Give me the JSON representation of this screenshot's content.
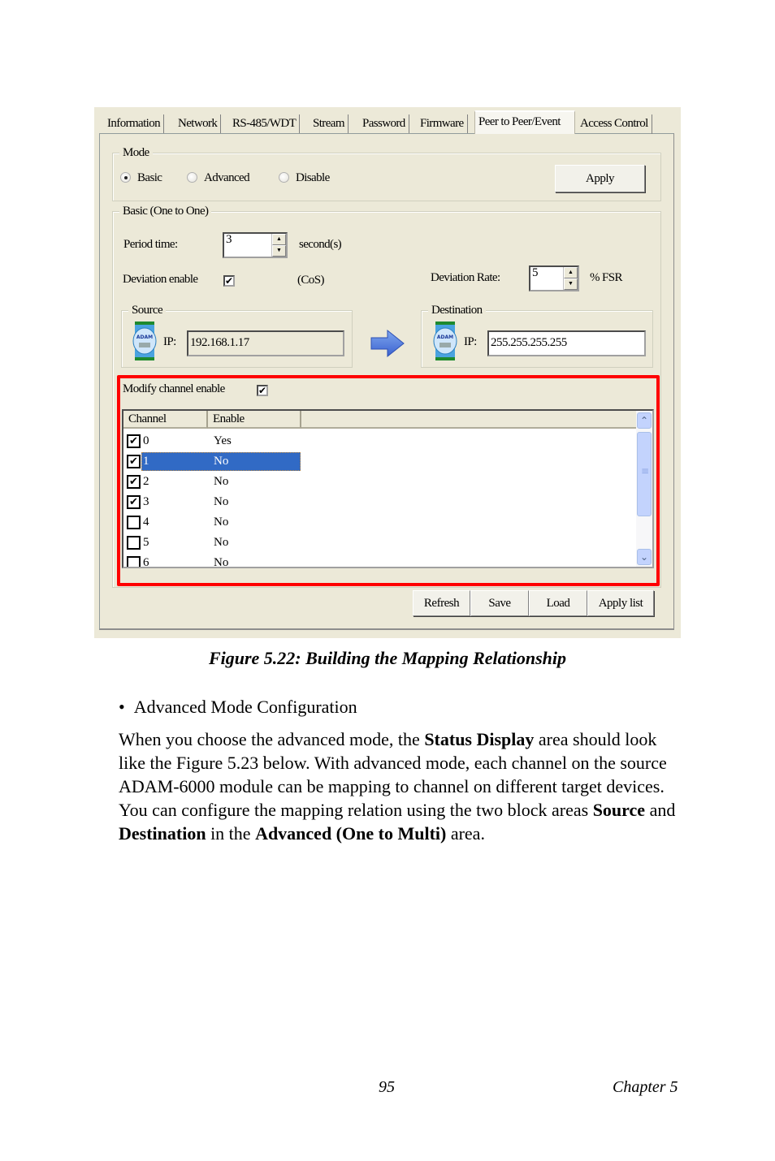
{
  "tabs": [
    {
      "label": "Information"
    },
    {
      "label": "Network"
    },
    {
      "label": "RS-485/WDT"
    },
    {
      "label": "Stream"
    },
    {
      "label": "Password"
    },
    {
      "label": "Firmware"
    },
    {
      "label": "Peer to Peer/Event",
      "active": true
    },
    {
      "label": "Access Control"
    }
  ],
  "mode": {
    "legend": "Mode",
    "options": [
      {
        "label": "Basic",
        "selected": true
      },
      {
        "label": "Advanced",
        "selected": false
      },
      {
        "label": "Disable",
        "selected": false
      }
    ],
    "apply_label": "Apply"
  },
  "basic": {
    "legend": "Basic (One to One)",
    "period_label": "Period time:",
    "period_value": "3",
    "period_unit": "second(s)",
    "deviation_label": "Deviation enable",
    "deviation_checked": "✔",
    "cos_label": "(CoS)",
    "rate_label": "Deviation Rate:",
    "rate_value": "5",
    "rate_unit": "% FSR"
  },
  "source": {
    "legend": "Source",
    "ip_label": "IP:",
    "ip": "192.168.1.17"
  },
  "destination": {
    "legend": "Destination",
    "ip_label": "IP:",
    "ip": "255.255.255.255"
  },
  "channels": {
    "modify_label": "Modify channel enable",
    "modify_checked": "✔",
    "headers": {
      "channel": "Channel",
      "enable": "Enable"
    },
    "rows": [
      {
        "checked": "✔",
        "channel": "0",
        "enable": "Yes"
      },
      {
        "checked": "✔",
        "channel": "1",
        "enable": "No",
        "selected": true
      },
      {
        "checked": "✔",
        "channel": "2",
        "enable": "No"
      },
      {
        "checked": "✔",
        "channel": "3",
        "enable": "No"
      },
      {
        "checked": "",
        "channel": "4",
        "enable": "No"
      },
      {
        "checked": "",
        "channel": "5",
        "enable": "No"
      },
      {
        "checked": "",
        "channel": "6",
        "enable": "No"
      }
    ]
  },
  "buttons": {
    "refresh": "Refresh",
    "save": "Save",
    "load": "Load",
    "apply_list": "Apply list"
  },
  "highlight_color": "#ff0000",
  "selection_color": "#316ac5",
  "document": {
    "caption": "Figure 5.22: Building the Mapping Relationship",
    "bullet": "Advanced Mode Configuration",
    "para": [
      {
        "t": "When you choose the advanced mode, the "
      },
      {
        "t": "Status Display",
        "b": true
      },
      {
        "t": " area should look like the Figure 5.23 below. With advanced mode, each channel on the source ADAM-6000 module can be mapping to channel on different target devices. You can configure the mapping relation using the two block areas "
      },
      {
        "t": "Source",
        "b": true
      },
      {
        "t": " and "
      },
      {
        "t": "Destination",
        "b": true
      },
      {
        "t": " in the "
      },
      {
        "t": "Advanced (One to Multi)",
        "b": true
      },
      {
        "t": " area."
      }
    ],
    "page_number": "95",
    "chapter": "Chapter 5"
  }
}
